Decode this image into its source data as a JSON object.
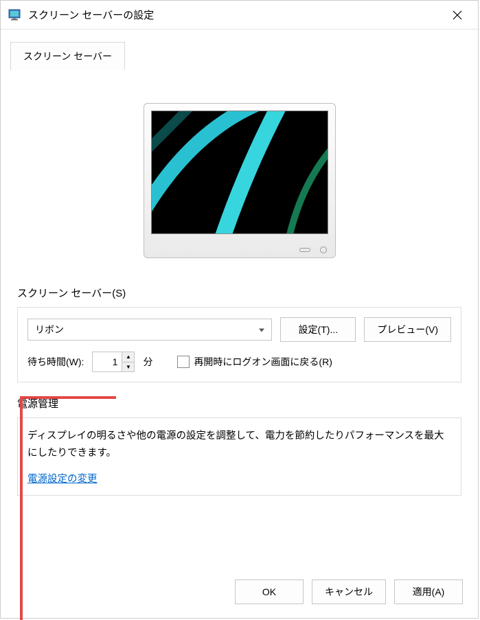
{
  "window": {
    "title": "スクリーン セーバーの設定"
  },
  "tab": {
    "label": "スクリーン セーバー"
  },
  "screensaver": {
    "group_label": "スクリーン セーバー(S)",
    "selected": "リボン",
    "settings_btn": "設定(T)...",
    "preview_btn": "プレビュー(V)",
    "wait_label": "待ち時間(W):",
    "wait_value": "1",
    "wait_unit": "分",
    "resume_checkbox": "再開時にログオン画面に戻る(R)",
    "resume_checked": false
  },
  "power": {
    "group_label": "電源管理",
    "description": "ディスプレイの明るさや他の電源の設定を調整して、電力を節約したりパフォーマンスを最大にしたりできます。",
    "link": "電源設定の変更"
  },
  "buttons": {
    "ok": "OK",
    "cancel": "キャンセル",
    "apply": "適用(A)"
  }
}
